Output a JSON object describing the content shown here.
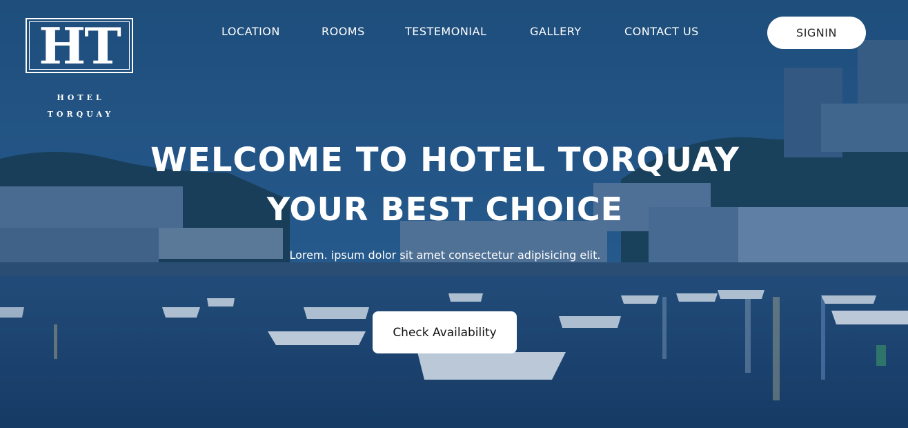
{
  "logo": {
    "mark": "HT",
    "name_line1": "HOTEL",
    "name_line2": "TORQUAY"
  },
  "nav": {
    "items": [
      {
        "label": "LOCATION"
      },
      {
        "label": "ROOMS"
      },
      {
        "label": "TESTEMONIAL"
      },
      {
        "label": "GALLERY"
      },
      {
        "label": "CONTACT US"
      }
    ],
    "signin_label": "SIGNIN"
  },
  "hero": {
    "headline_line1": "WELCOME TO HOTEL TORQUAY",
    "headline_line2": "YOUR BEST CHOICE",
    "tagline": "Lorem. ipsum dolor sit amet consectetur adipisicing elit.",
    "cta_label": "Check Availability"
  },
  "colors": {
    "overlay_blue": "#1f4f80",
    "button_bg": "#ffffff",
    "text": "#ffffff"
  }
}
